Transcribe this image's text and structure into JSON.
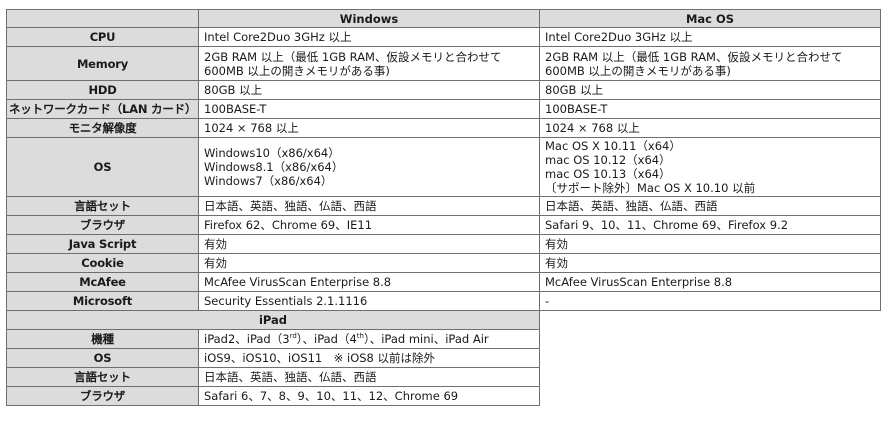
{
  "header": {
    "col1": "",
    "col2": "Windows",
    "col3": "Mac OS"
  },
  "pc_rows": [
    {
      "label": "CPU",
      "windows": [
        "Intel Core2Duo 3GHz 以上"
      ],
      "mac": [
        "Intel Core2Duo 3GHz 以上"
      ]
    },
    {
      "label": "Memory",
      "windows": [
        "2GB RAM 以上（最低 1GB RAM、仮設メモリと合わせて",
        "600MB 以上の開きメモリがある事)"
      ],
      "mac": [
        "2GB RAM 以上（最低 1GB RAM、仮設メモリと合わせて",
        "600MB 以上の開きメモリがある事)"
      ]
    },
    {
      "label": "HDD",
      "windows": [
        "80GB 以上"
      ],
      "mac": [
        "80GB 以上"
      ]
    },
    {
      "label": "ネットワークカード（LAN カード）",
      "windows": [
        "100BASE-T"
      ],
      "mac": [
        "100BASE-T"
      ]
    },
    {
      "label": "モニタ解像度",
      "windows": [
        "1024 × 768 以上"
      ],
      "mac": [
        "1024 × 768 以上"
      ]
    },
    {
      "label": "OS",
      "windows": [
        "Windows10（x86/x64）",
        "Windows8.1（x86/x64）",
        "Windows7（x86/x64）"
      ],
      "mac": [
        "Mac OS X 10.11（x64）",
        "mac OS 10.12（x64）",
        "mac OS 10.13（x64）",
        "〔サポート除外〕Mac OS X 10.10 以前"
      ]
    },
    {
      "label": "言語セット",
      "windows": [
        "日本語、英語、独語、仏語、西語"
      ],
      "mac": [
        "日本語、英語、独語、仏語、西語"
      ]
    },
    {
      "label": "ブラウザ",
      "windows": [
        "Firefox 62、Chrome 69、IE11"
      ],
      "mac": [
        "Safari 9、10、11、Chrome 69、Firefox 9.2"
      ]
    },
    {
      "label": "Java Script",
      "windows": [
        "有効"
      ],
      "mac": [
        "有効"
      ]
    },
    {
      "label": "Cookie",
      "windows": [
        "有効"
      ],
      "mac": [
        "有効"
      ]
    },
    {
      "label": "McAfee",
      "windows": [
        "McAfee VirusScan Enterprise 8.8"
      ],
      "mac": [
        "McAfee VirusScan Enterprise 8.8"
      ]
    },
    {
      "label": "Microsoft",
      "windows": [
        "Security Essentials 2.1.1116"
      ],
      "mac": [
        "-"
      ]
    }
  ],
  "ipad": {
    "header": "iPad",
    "model": {
      "label": "機種",
      "parts": [
        "iPad2、iPad（3",
        "rd",
        "）、iPad（4",
        "th",
        "）、iPad mini、iPad Air"
      ]
    },
    "os": {
      "label": "OS",
      "value": "iOS9、iOS10、iOS11　※ iOS8 以前は除外"
    },
    "lang": {
      "label": "言語セット",
      "value": "日本語、英語、独語、仏語、西語"
    },
    "browser": {
      "label": "ブラウザ",
      "value": "Safari 6、7、8、9、10、11、12、Chrome 69"
    }
  }
}
